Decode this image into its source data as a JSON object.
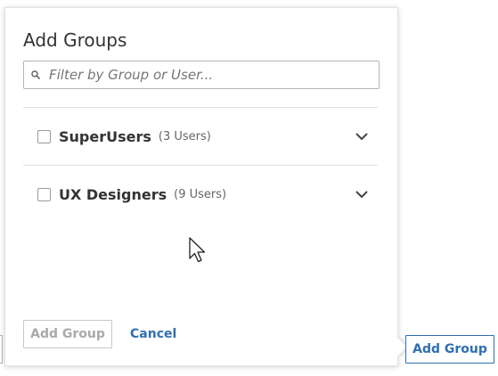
{
  "popover": {
    "title": "Add Groups",
    "filter": {
      "placeholder": "Filter by Group or User...",
      "value": ""
    },
    "groups": [
      {
        "name": "SuperUsers",
        "count": "(3 Users)",
        "checked": false,
        "expand_icon": "chevron-down-icon"
      },
      {
        "name": "UX Designers",
        "count": "(9 Users)",
        "checked": false,
        "expand_icon": "chevron-down-icon"
      }
    ],
    "footer": {
      "add_group_label": "Add Group",
      "add_group_enabled": false,
      "cancel_label": "Cancel"
    }
  },
  "page": {
    "add_group_label": "Add Group"
  },
  "colors": {
    "accent": "#2f6fb3",
    "text": "#333333",
    "muted": "#666666",
    "disabled": "#a9a9a9",
    "border": "#b5b5b5"
  }
}
